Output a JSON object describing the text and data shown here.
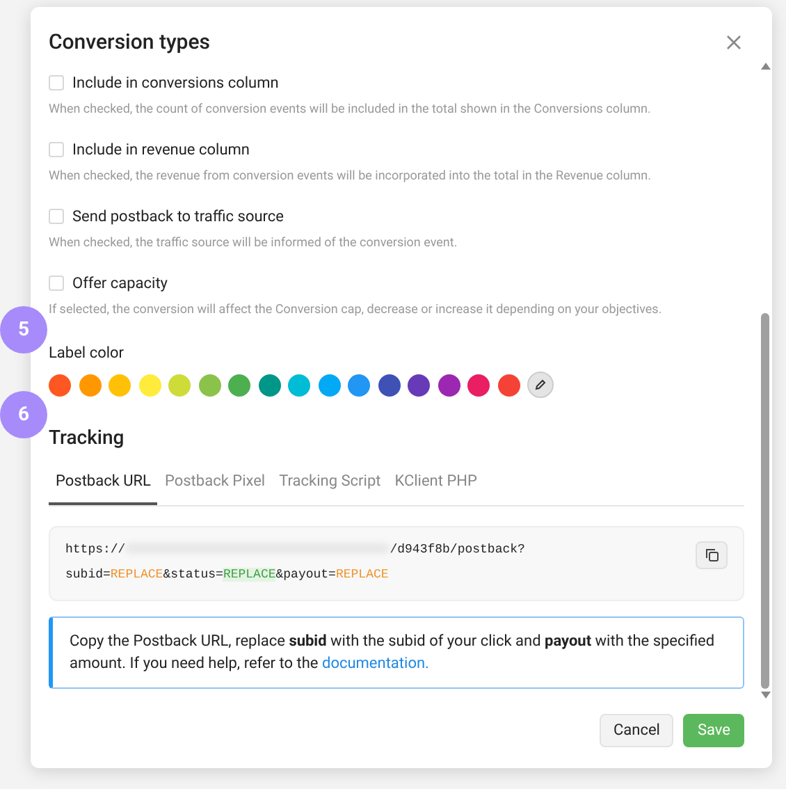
{
  "dialog": {
    "title": "Conversion types"
  },
  "options": [
    {
      "label": "Include in conversions column",
      "checked": false,
      "hint": "When checked, the count of conversion events will be included in the total shown in the Conversions column."
    },
    {
      "label": "Include in revenue column",
      "checked": false,
      "hint": "When checked, the revenue from conversion events will be incorporated into the total in the Revenue column."
    },
    {
      "label": "Send postback to traffic source",
      "checked": false,
      "hint": "When checked, the traffic source will be informed of the conversion event."
    },
    {
      "label": "Offer capacity",
      "checked": false,
      "hint": "If selected, the conversion will affect the Conversion cap, decrease or increase it depending on your objectives."
    }
  ],
  "step_badges": [
    "5",
    "6"
  ],
  "label_color": {
    "label": "Label color",
    "swatches": [
      {
        "color": "#ff5722",
        "selected": false
      },
      {
        "color": "#ff9800",
        "selected": false
      },
      {
        "color": "#ffc107",
        "selected": false
      },
      {
        "color": "#ffeb3b",
        "selected": false
      },
      {
        "color": "#cddc39",
        "selected": false
      },
      {
        "color": "#8bc34a",
        "selected": false
      },
      {
        "color": "#4caf50",
        "selected": false
      },
      {
        "color": "#009688",
        "selected": false
      },
      {
        "color": "#00bcd4",
        "selected": false
      },
      {
        "color": "#03a9f4",
        "selected": false
      },
      {
        "color": "#2196f3",
        "selected": false
      },
      {
        "color": "#3f51b5",
        "selected": false
      },
      {
        "color": "#673ab7",
        "selected": false
      },
      {
        "color": "#9c27b0",
        "selected": false
      },
      {
        "color": "#e91e63",
        "selected": false
      },
      {
        "color": "#f44336",
        "selected": false
      }
    ]
  },
  "tracking": {
    "title": "Tracking",
    "tabs": [
      {
        "label": "Postback URL",
        "selected": true
      },
      {
        "label": "Postback Pixel",
        "selected": false
      },
      {
        "label": "Tracking Script",
        "selected": false
      },
      {
        "label": "KClient PHP",
        "selected": false
      }
    ],
    "url_lines": [
      [
        {
          "kind": "text",
          "text": "https://"
        },
        {
          "kind": "redacted"
        },
        {
          "kind": "text",
          "text": "/d943f8b/postback?"
        }
      ],
      [
        {
          "kind": "text",
          "text": "subid="
        },
        {
          "kind": "param",
          "text": "REPLACE"
        },
        {
          "kind": "text",
          "text": "&status="
        },
        {
          "kind": "highlight",
          "text": "REPLACE"
        },
        {
          "kind": "text",
          "text": "&payout="
        },
        {
          "kind": "param",
          "text": "REPLACE"
        }
      ]
    ],
    "info": {
      "text": "Copy the Postback URL, replace **subid** with the subid of your click and **payout** with the specified amount. If you need help, refer to the",
      "link": "documentation."
    }
  },
  "buttons": [
    {
      "label": "Cancel",
      "kind": "secondary"
    },
    {
      "label": "Save",
      "kind": "primary"
    }
  ]
}
